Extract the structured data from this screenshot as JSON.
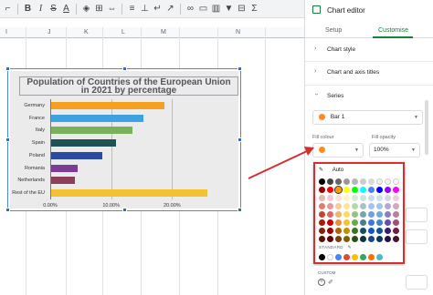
{
  "toolbar": {
    "icons": [
      "paint-format-icon",
      "text-color-icon",
      "borders-icon",
      "merge-icon",
      "align-icon",
      "valign-icon",
      "wrap-icon",
      "rotate-icon",
      "link-icon",
      "comment-icon",
      "chart-icon",
      "filter-icon",
      "functions-icon"
    ],
    "bold": "B",
    "italic": "I",
    "strike": "S",
    "text_color": "A"
  },
  "columns": [
    "I",
    "J",
    "K",
    "L",
    "M",
    "N"
  ],
  "chart": {
    "title": "Population of Countries of the European Union in 2021 by percentage",
    "title_line1": "Population of Countries of the European Union",
    "title_line2": "in 2021 by percentage"
  },
  "chart_data": {
    "type": "bar",
    "orientation": "horizontal",
    "title": "Population of Countries of the European Union in 2021 by percentage",
    "categories": [
      "Germany",
      "France",
      "Italy",
      "Spain",
      "Poland",
      "Romania",
      "Netherlands",
      "Rest of the EU"
    ],
    "values": [
      18.6,
      15.2,
      13.3,
      10.6,
      8.4,
      4.3,
      3.9,
      25.7
    ],
    "colors": [
      "#f6a022",
      "#3fa2e0",
      "#78b159",
      "#1e5356",
      "#2b4ba3",
      "#7c3d97",
      "#8c3f5a",
      "#f1c232"
    ],
    "xlim": [
      0,
      30
    ],
    "x_ticks": [
      "0.00%",
      "10.00%",
      "20.00%"
    ],
    "grid": true,
    "legend": "none"
  },
  "panel": {
    "title": "Chart editor",
    "tabs": [
      "Setup",
      "Customise"
    ],
    "active_tab": "Customise",
    "sections": [
      "Chart style",
      "Chart and axis titles",
      "Series"
    ],
    "series_select": "Bar 1",
    "fill_colour_label": "Fill colour",
    "fill_opacity_label": "Fill opacity",
    "fill_opacity_value": "100%",
    "fill_colour": "#ff8c1a"
  },
  "colour_picker": {
    "auto_label": "Auto",
    "standard_label": "STANDARD",
    "custom_label": "CUSTOM",
    "rows": [
      [
        "#000000",
        "#434343",
        "#666666",
        "#999999",
        "#b7b7b7",
        "#cccccc",
        "#d9d9d9",
        "#efefef",
        "#f3f3f3",
        "#ffffff"
      ],
      [
        "#980000",
        "#ff0000",
        "#ff9900",
        "#ffff00",
        "#00ff00",
        "#00ffff",
        "#4a86e8",
        "#0000ff",
        "#9900ff",
        "#ff00ff"
      ],
      [
        "#e6b8af",
        "#f4cccc",
        "#fce5cd",
        "#fff2cc",
        "#d9ead3",
        "#d0e0e3",
        "#c9daf8",
        "#cfe2f3",
        "#d9d2e9",
        "#ead1dc"
      ],
      [
        "#dd7e6b",
        "#ea9999",
        "#f9cb9c",
        "#ffe599",
        "#b6d7a8",
        "#a2c4c9",
        "#a4c2f4",
        "#9fc5e8",
        "#b4a7d6",
        "#d5a6bd"
      ],
      [
        "#cc4125",
        "#e06666",
        "#f6b26b",
        "#ffd966",
        "#93c47d",
        "#76a5af",
        "#6d9eeb",
        "#6fa8dc",
        "#8e7cc3",
        "#c27ba0"
      ],
      [
        "#a61c00",
        "#cc0000",
        "#e69138",
        "#f1c232",
        "#6aa84f",
        "#45818e",
        "#3c78d8",
        "#3d85c6",
        "#674ea7",
        "#a64d79"
      ],
      [
        "#85200c",
        "#990000",
        "#b45f06",
        "#bf9000",
        "#38761d",
        "#134f5c",
        "#1155cc",
        "#0b5394",
        "#351c75",
        "#741b47"
      ],
      [
        "#5b0f00",
        "#660000",
        "#783f04",
        "#7f6000",
        "#274e13",
        "#0c343d",
        "#1c4587",
        "#073763",
        "#20124d",
        "#4c1130"
      ]
    ],
    "standard": [
      "#000000",
      "#ffffff",
      "#4285f4",
      "#ea4335",
      "#fbbc04",
      "#34a853",
      "#ff6d01",
      "#46bdc6"
    ],
    "selected": "#ff9900"
  },
  "annotation_color": "#d32f2f"
}
